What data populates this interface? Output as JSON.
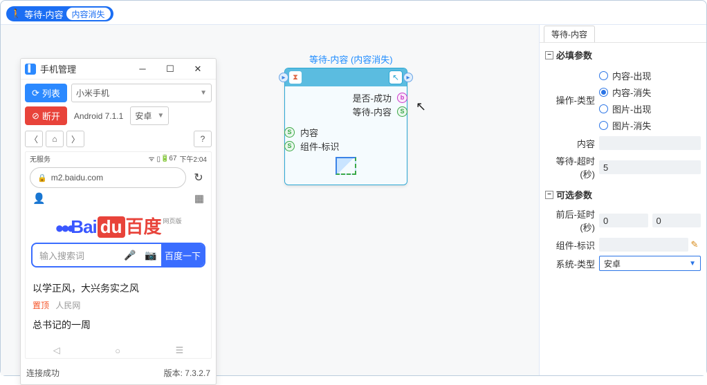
{
  "topbar": {
    "badge_main": "等待-内容",
    "badge_sub": "内容消失"
  },
  "phone": {
    "title": "手机管理",
    "list_btn": "列表",
    "device_sel": "小米手机",
    "disc_btn": "断开",
    "os_text": "Android 7.1.1",
    "plat_sel": "安卓",
    "status_left": "无服务",
    "status_right": "下午2:04",
    "battery": "67",
    "url": "m2.baidu.com",
    "logo_bai": "Bai",
    "logo_du": "du",
    "logo_cn": "百度",
    "logo_tag": "网页版",
    "search_ph": "输入搜索词",
    "search_go": "百度一下",
    "feed1": "以学正风，大兴务实之风",
    "feed_pin": "置顶",
    "feed_src": "人民网",
    "feed2": "总书记的一周",
    "conn_status": "连接成功",
    "version_label": "版本: 7.3.2.7"
  },
  "node": {
    "title": "等待-内容 (内容消失)",
    "out1": "是否-成功",
    "out2": "等待-内容",
    "in1": "内容",
    "in2": "组件-标识"
  },
  "rpanel": {
    "tab": "等待-内容",
    "sec1": "必填参数",
    "op_label": "操作-类型",
    "radios": [
      "内容-出现",
      "内容-消失",
      "图片-出现",
      "图片-消失"
    ],
    "radio_selected": 1,
    "content_label": "内容",
    "timeout_label": "等待-超时(秒)",
    "timeout_val": "5",
    "sec2": "可选参数",
    "delay_label": "前后-延时(秒)",
    "delay_a": "0",
    "delay_b": "0",
    "comp_label": "组件-标识",
    "sys_label": "系统-类型",
    "sys_val": "安卓"
  }
}
